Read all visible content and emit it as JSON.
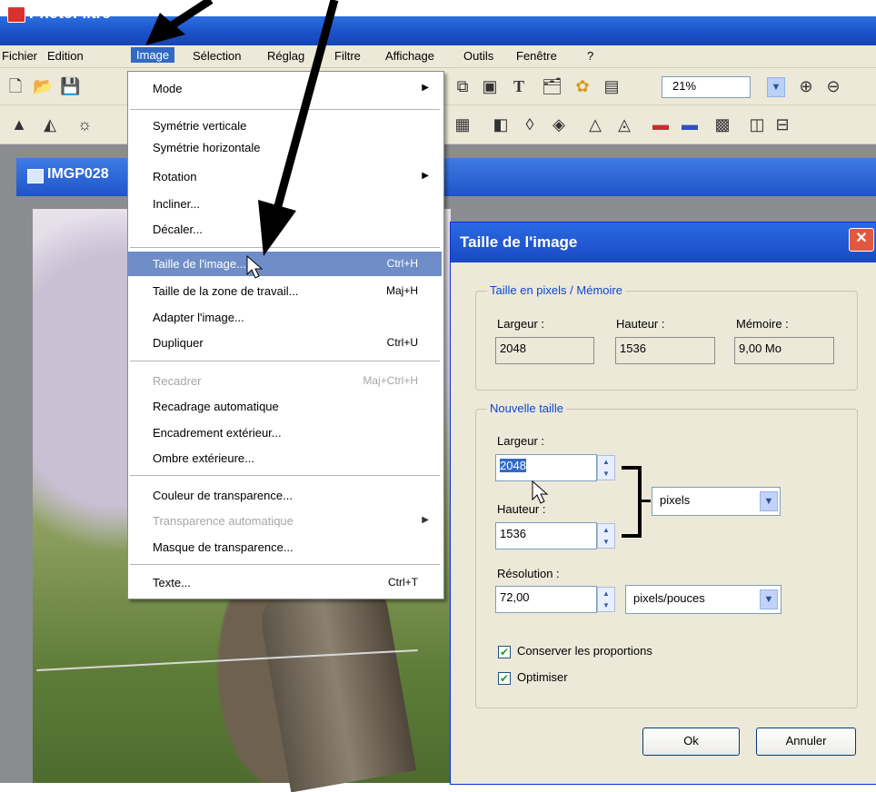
{
  "app": {
    "title": "PhotoFiltre"
  },
  "menubar": {
    "items": [
      "Fichier",
      "Edition",
      "Image",
      "Sélection",
      "Réglag",
      "Filtre",
      "Affichage",
      "Outils",
      "Fenêtre",
      "?"
    ]
  },
  "toolbar": {
    "zoom_value": "21%"
  },
  "document": {
    "title": "IMGP028"
  },
  "image_menu": {
    "items": [
      {
        "label": "Mode",
        "shortcut": "",
        "submenu": true,
        "disabled": false
      },
      {
        "label": "Symétrie verticale",
        "shortcut": "",
        "submenu": false,
        "disabled": false
      },
      {
        "label": "Symétrie horizontale",
        "shortcut": "",
        "submenu": false,
        "disabled": false
      },
      {
        "label": "Rotation",
        "shortcut": "",
        "submenu": true,
        "disabled": false
      },
      {
        "label": "Incliner...",
        "shortcut": "",
        "submenu": false,
        "disabled": false
      },
      {
        "label": "Décaler...",
        "shortcut": "",
        "submenu": false,
        "disabled": false
      },
      {
        "label": "Taille de l'image...",
        "shortcut": "Ctrl+H",
        "submenu": false,
        "disabled": false,
        "highlighted": true
      },
      {
        "label": "Taille de la zone de travail...",
        "shortcut": "Maj+H",
        "submenu": false,
        "disabled": false
      },
      {
        "label": "Adapter l'image...",
        "shortcut": "",
        "submenu": false,
        "disabled": false
      },
      {
        "label": "Dupliquer",
        "shortcut": "Ctrl+U",
        "submenu": false,
        "disabled": false
      },
      {
        "label": "Recadrer",
        "shortcut": "Maj+Ctrl+H",
        "submenu": false,
        "disabled": true
      },
      {
        "label": "Recadrage automatique",
        "shortcut": "",
        "submenu": false,
        "disabled": false
      },
      {
        "label": "Encadrement extérieur...",
        "shortcut": "",
        "submenu": false,
        "disabled": false
      },
      {
        "label": "Ombre extérieure...",
        "shortcut": "",
        "submenu": false,
        "disabled": false
      },
      {
        "label": "Couleur de transparence...",
        "shortcut": "",
        "submenu": false,
        "disabled": false
      },
      {
        "label": "Transparence automatique",
        "shortcut": "",
        "submenu": true,
        "disabled": true
      },
      {
        "label": "Masque de transparence...",
        "shortcut": "",
        "submenu": false,
        "disabled": false
      },
      {
        "label": "Texte...",
        "shortcut": "Ctrl+T",
        "submenu": false,
        "disabled": false
      }
    ]
  },
  "dialog": {
    "title": "Taille de l'image",
    "close_label": "✕",
    "pixels_group": {
      "legend": "Taille en pixels / Mémoire",
      "width_label": "Largeur :",
      "width_value": "2048",
      "height_label": "Hauteur :",
      "height_value": "1536",
      "memory_label": "Mémoire :",
      "memory_value": "9,00 Mo"
    },
    "new_size_group": {
      "legend": "Nouvelle taille",
      "width_label": "Largeur :",
      "width_value": "2048",
      "height_label": "Hauteur :",
      "height_value": "1536",
      "unit_value": "pixels",
      "resolution_label": "Résolution :",
      "resolution_value": "72,00",
      "resolution_unit_value": "pixels/pouces",
      "keep_proportions_label": "Conserver les proportions",
      "keep_proportions": true,
      "optimize_label": "Optimiser",
      "optimize": true
    },
    "ok_label": "Ok",
    "cancel_label": "Annuler"
  }
}
